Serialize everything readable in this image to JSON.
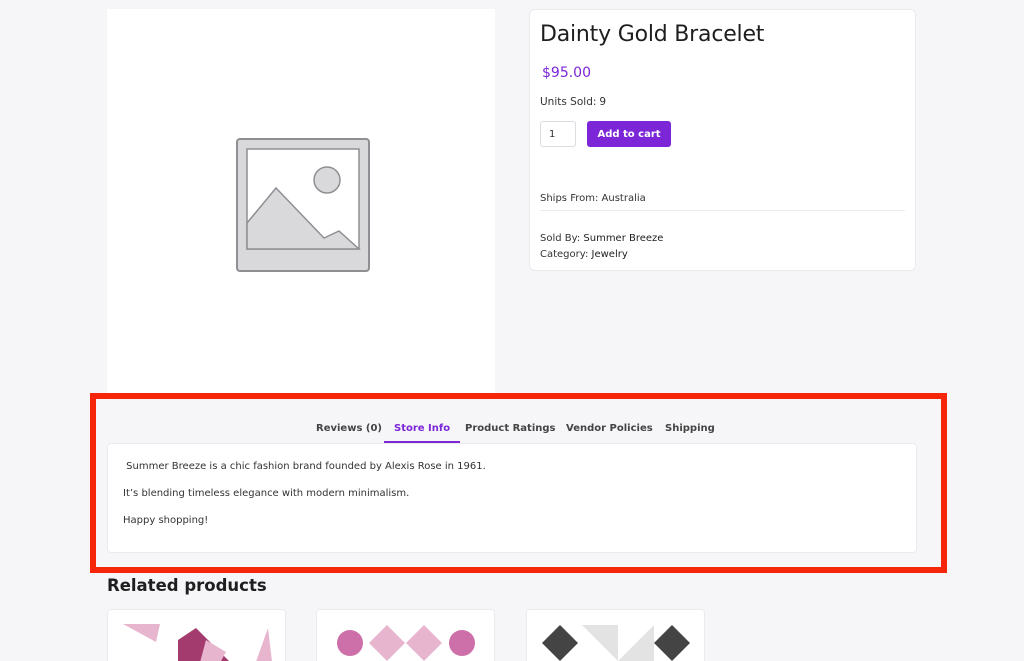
{
  "product": {
    "title": "Dainty Gold Bracelet",
    "price": "$95.00",
    "units_sold_label": "Units Sold:",
    "units_sold_value": "9",
    "quantity": "1",
    "add_to_cart_label": "Add to cart",
    "ships_from_label": "Ships From:",
    "ships_from_value": "Australia",
    "sold_by_label": "Sold By:",
    "sold_by_value": "Summer Breeze",
    "category_label": "Category:",
    "category_value": "Jewelry"
  },
  "tabs": [
    {
      "label": "Reviews (0)",
      "active": false
    },
    {
      "label": "Store Info",
      "active": true
    },
    {
      "label": "Product Ratings",
      "active": false
    },
    {
      "label": "Vendor Policies",
      "active": false
    },
    {
      "label": "Shipping",
      "active": false
    }
  ],
  "store_info": {
    "line1": " Summer Breeze is a chic fashion brand founded by Alexis Rose in 1961.",
    "line2": "It’s blending timeless elegance with modern minimalism.",
    "line3": "Happy shopping!"
  },
  "related": {
    "title": "Related products"
  },
  "colors": {
    "accent": "#7c26d8",
    "highlight": "#f5260a",
    "background": "#f6f6f9"
  },
  "icons": {
    "placeholder": "image-placeholder-icon"
  }
}
